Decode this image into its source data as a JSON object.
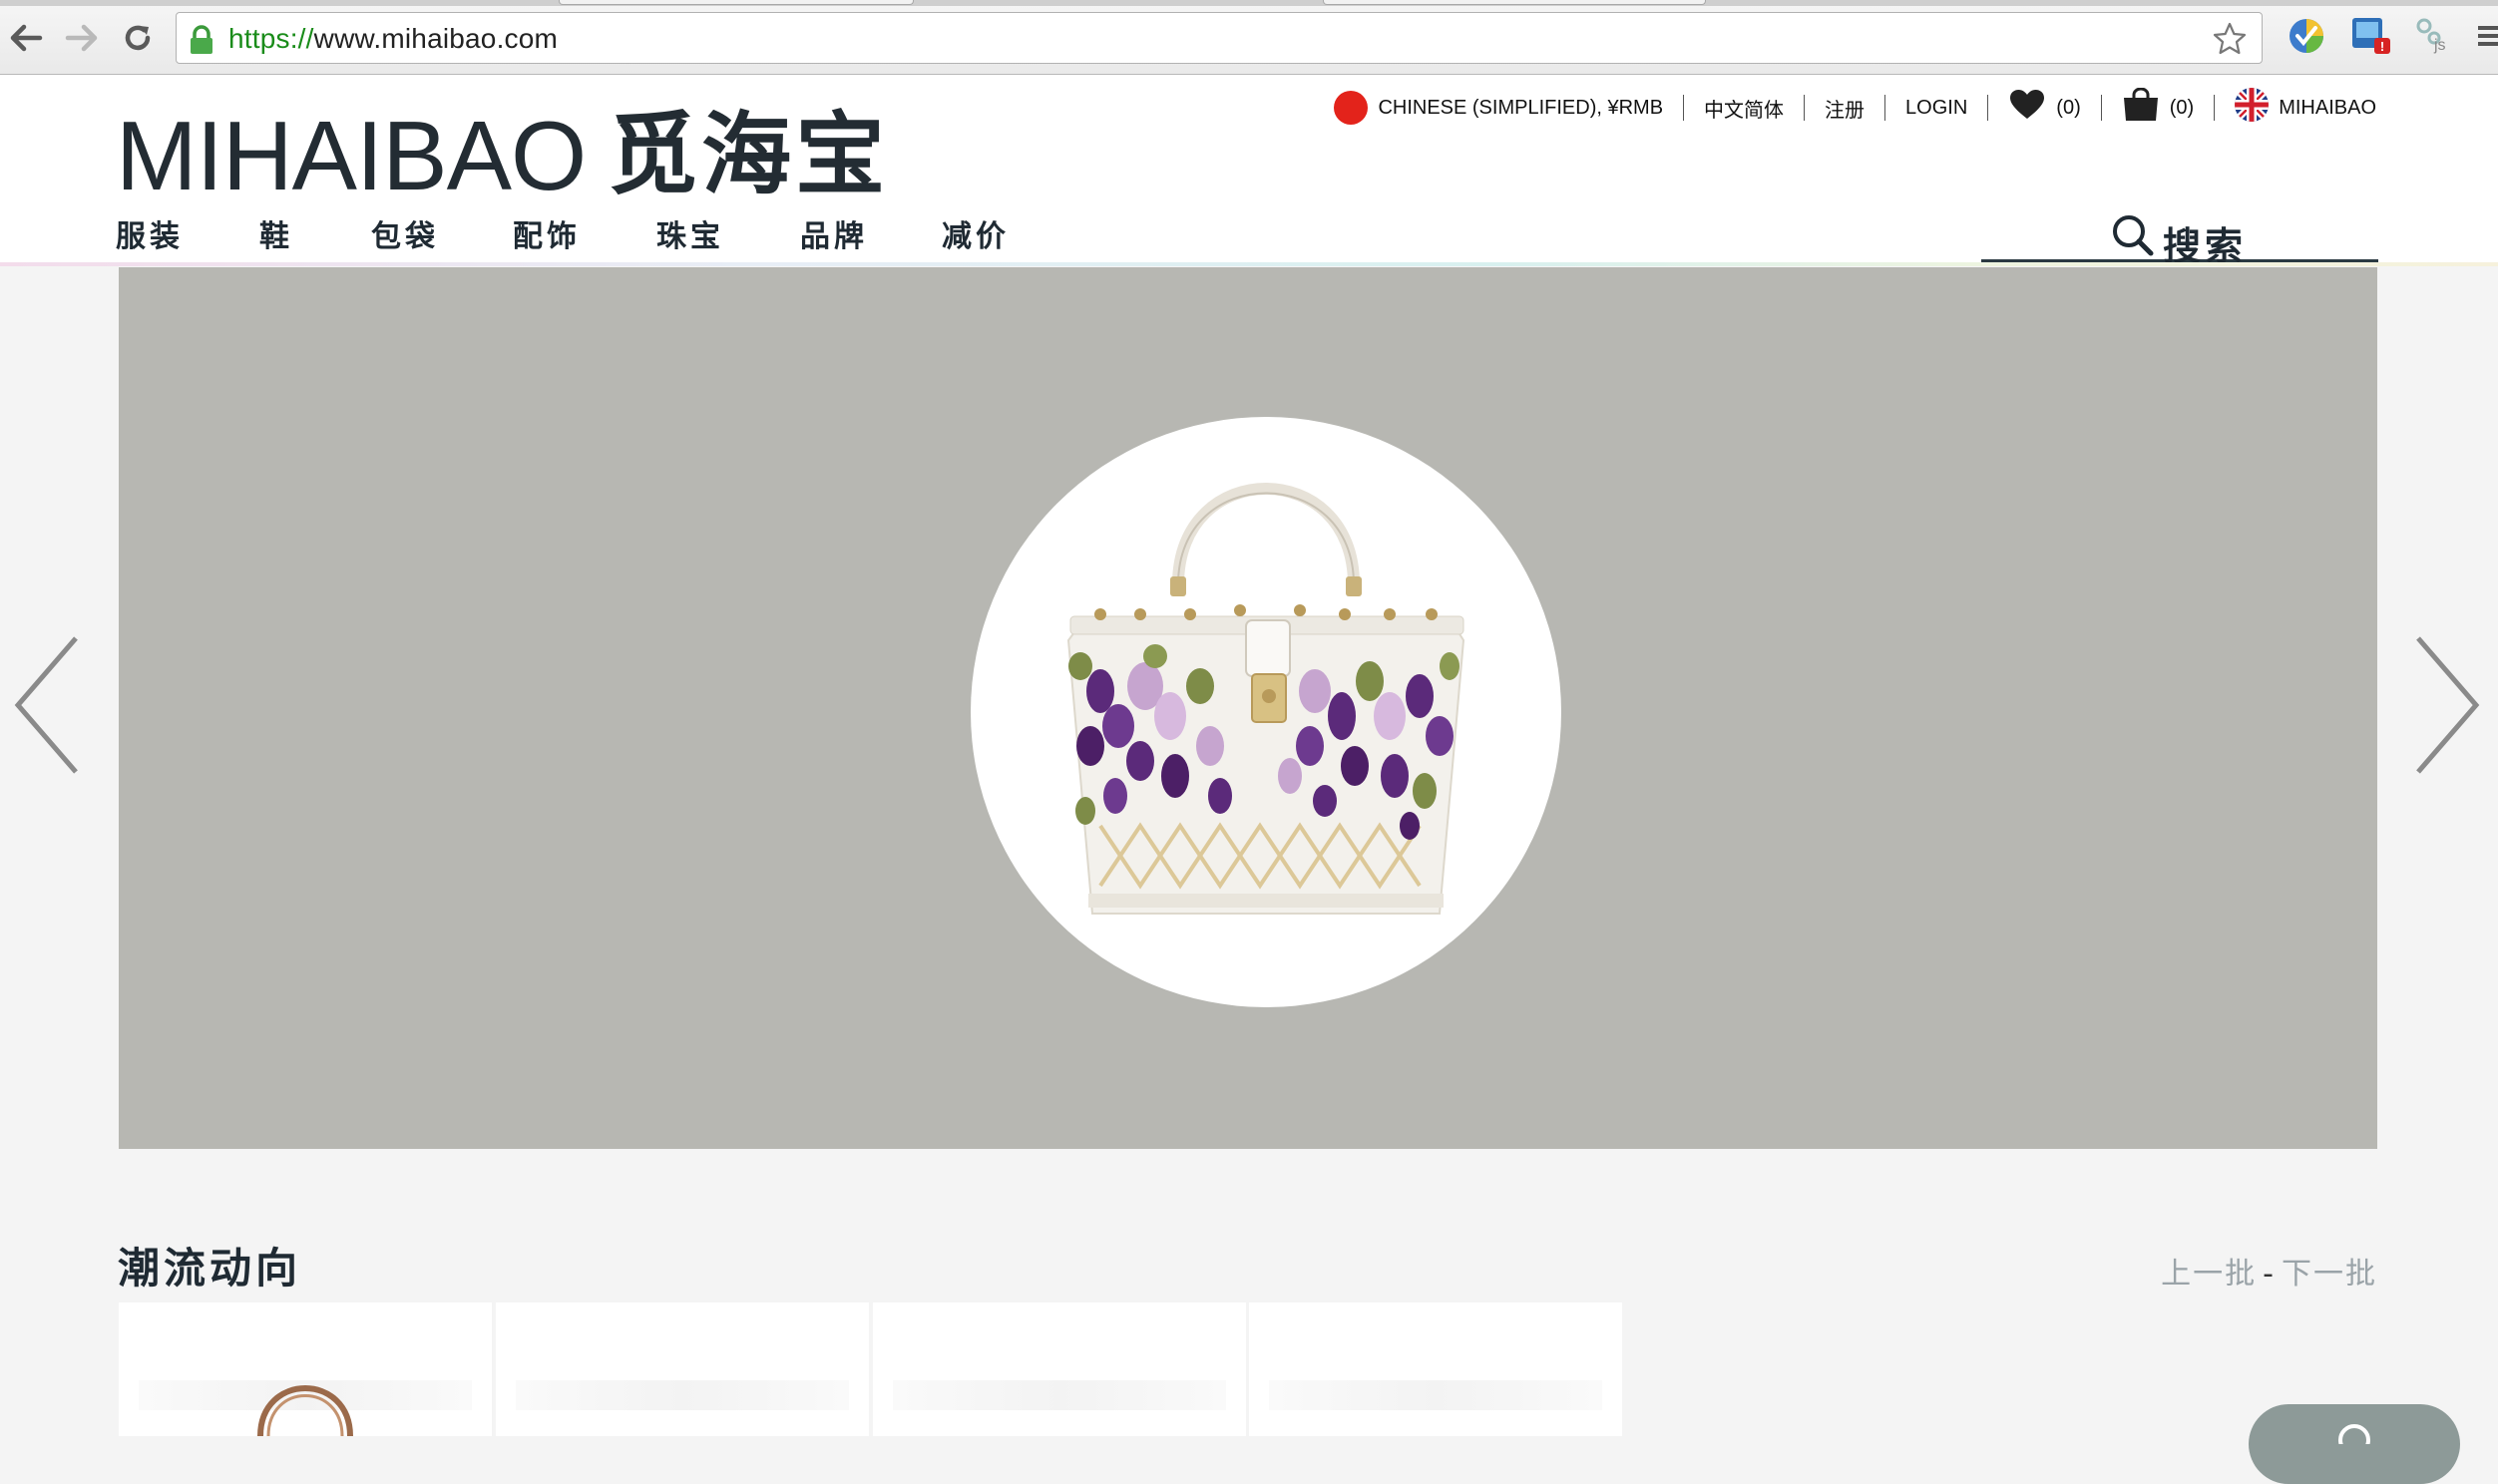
{
  "browser": {
    "url_scheme": "https://",
    "url_host": "www.mihaibao.com"
  },
  "site": {
    "logo_latin": "MIHAIBAO",
    "logo_cjk": "觅海宝"
  },
  "topbar": {
    "region": "CHINESE (SIMPLIFIED), ¥RMB",
    "language": "中文简体",
    "register": "注册",
    "login": "LOGIN",
    "wishlist_count": "(0)",
    "cart_count": "(0)",
    "account": "MIHAIBAO"
  },
  "nav": {
    "items": [
      "服装",
      "鞋",
      "包袋",
      "配饰",
      "珠宝",
      "品牌",
      "减价"
    ]
  },
  "search": {
    "label": "搜索"
  },
  "trends": {
    "title": "潮流动向",
    "prev": "上一批",
    "sep": "-",
    "next": "下一批"
  },
  "colors": {
    "hero_bg": "#b7b7b2",
    "brand_dark": "#232c33",
    "cn_flag_red": "#e3231b"
  }
}
